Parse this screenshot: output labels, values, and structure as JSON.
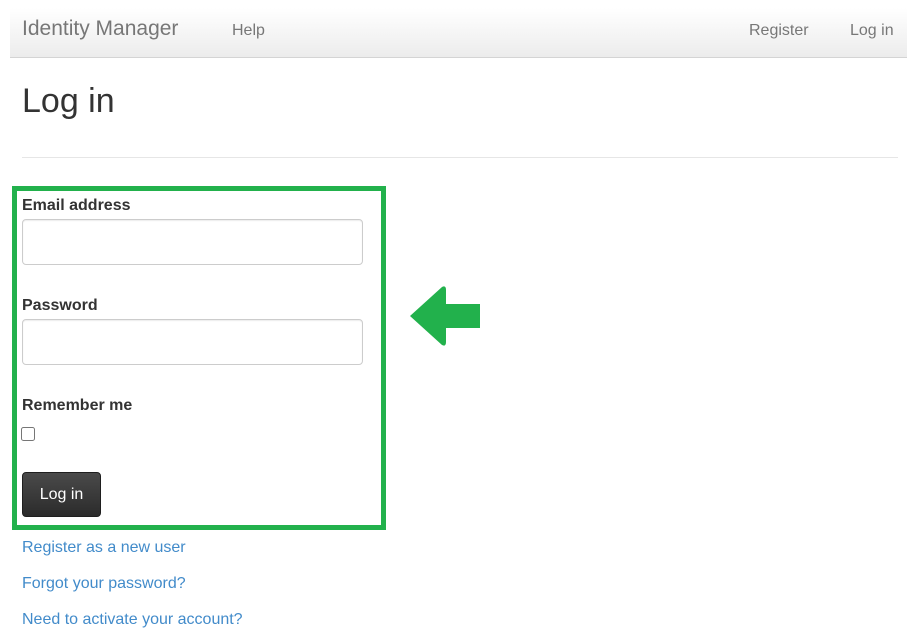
{
  "navbar": {
    "brand": "Identity Manager",
    "help": "Help",
    "register": "Register",
    "login": "Log in"
  },
  "page": {
    "title": "Log in"
  },
  "form": {
    "email_label": "Email address",
    "email_value": "",
    "password_label": "Password",
    "password_value": "",
    "remember_label": "Remember me",
    "remember_checked": false,
    "submit_label": "Log in"
  },
  "links": {
    "register": "Register as a new user",
    "forgot": "Forgot your password?",
    "activate": "Need to activate your account?"
  },
  "colors": {
    "highlight": "#22b14c",
    "link": "#428bca",
    "button": "#333333"
  },
  "icons": {
    "annotation_arrow": "left-arrow-icon"
  }
}
